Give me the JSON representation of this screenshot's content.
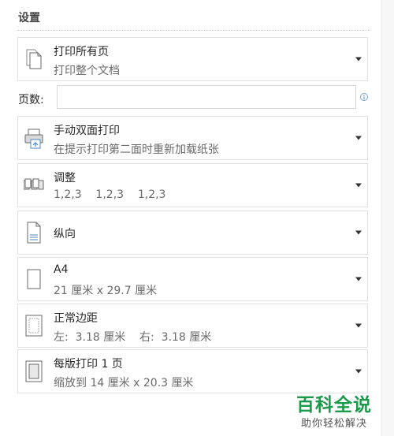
{
  "section": {
    "title": "设置"
  },
  "print_range": {
    "title": "打印所有页",
    "subtitle": "打印整个文档",
    "icon": "pages-stack-icon"
  },
  "pages": {
    "label": "页数:",
    "value": "",
    "placeholder": "",
    "info_icon_glyph": "i"
  },
  "duplex": {
    "title": "手动双面打印",
    "subtitle": "在提示打印第二面时重新加载纸张",
    "icon": "printer-duplex-icon"
  },
  "collate": {
    "title": "调整",
    "subtitle": "1,2,3    1,2,3    1,2,3",
    "icon": "collate-icon"
  },
  "orientation": {
    "title": "纵向",
    "icon": "portrait-page-icon"
  },
  "paper_size": {
    "title": "A4",
    "subtitle": "21 厘米 x 29.7 厘米",
    "icon": "paper-size-icon"
  },
  "margins": {
    "title": "正常边距",
    "subtitle": "左:  3.18 厘米    右:  3.18 厘米",
    "icon": "margins-icon"
  },
  "pages_per_sheet": {
    "title": "每版打印 1 页",
    "subtitle": "缩放到 14 厘米 x 20.3 厘米",
    "icon": "pages-per-sheet-icon"
  },
  "watermark": {
    "main": "百科全说",
    "sub": "助你轻松解决",
    "color": "#1c9a4b"
  }
}
